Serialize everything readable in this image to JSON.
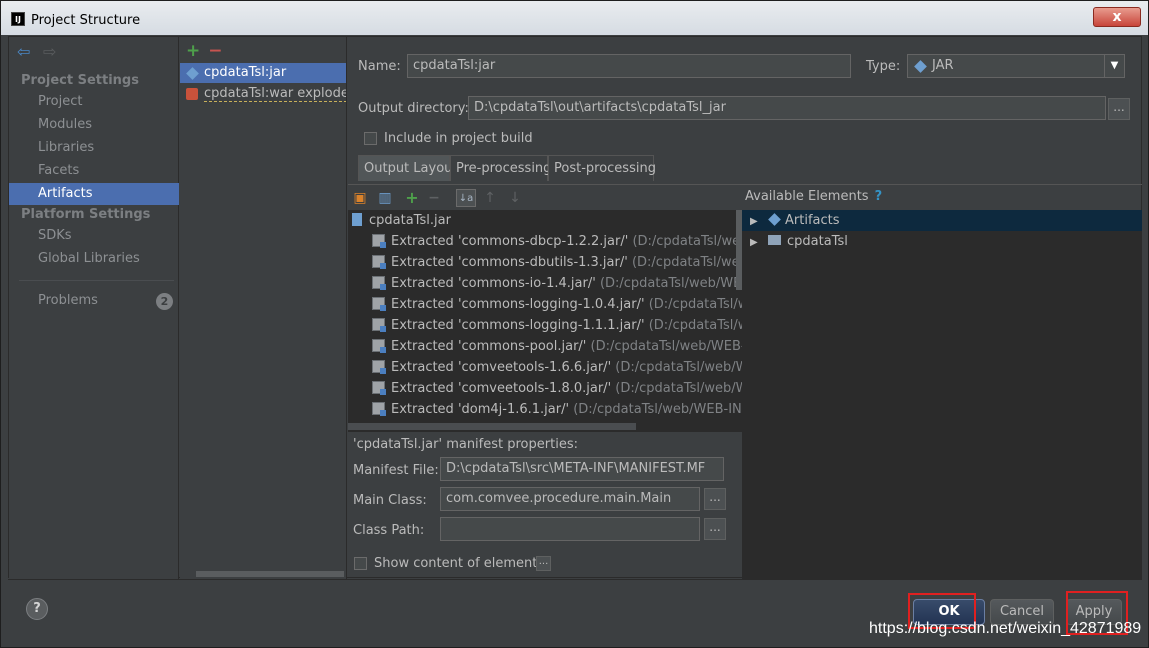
{
  "window": {
    "title": "Project Structure",
    "app_icon": "IJ",
    "close_label": "x"
  },
  "nav": {
    "back_icon": "arrow-left-icon",
    "forward_icon": "arrow-right-icon",
    "project_settings_header": "Project Settings",
    "project_items": [
      "Project",
      "Modules",
      "Libraries",
      "Facets",
      "Artifacts"
    ],
    "selected_item": "Artifacts",
    "platform_settings_header": "Platform Settings",
    "platform_items": [
      "SDKs",
      "Global Libraries"
    ],
    "problems_label": "Problems",
    "problems_count": "2"
  },
  "artifacts": {
    "add_icon": "+",
    "remove_icon": "−",
    "items": [
      {
        "label": "cpdataTsl:jar",
        "icon": "jar-icon",
        "selected": true
      },
      {
        "label": "cpdataTsl:war exploded",
        "icon": "war-icon",
        "selected": false
      }
    ]
  },
  "editor": {
    "name_label": "Name:",
    "name_value": "cpdataTsl:jar",
    "type_label": "Type:",
    "type_value": "JAR",
    "type_arrow": "▼",
    "output_dir_label": "Output directory:",
    "output_dir_value": "D:\\cpdataTsl\\out\\artifacts\\cpdataTsl_jar",
    "include_build_label": "Include in project build",
    "include_build_checked": false,
    "tabs": [
      "Output Layout",
      "Pre-processing",
      "Post-processing"
    ],
    "active_tab": "Output Layout",
    "ellipsis": "..."
  },
  "layout": {
    "root": "cpdataTsl.jar",
    "entries": [
      {
        "name": "Extracted 'commons-dbcp-1.2.2.jar/'",
        "path": "(D:/cpdataTsl/web/WEB-"
      },
      {
        "name": "Extracted 'commons-dbutils-1.3.jar/'",
        "path": "(D:/cpdataTsl/web/WEB-"
      },
      {
        "name": "Extracted 'commons-io-1.4.jar/'",
        "path": "(D:/cpdataTsl/web/WEB-INF/"
      },
      {
        "name": "Extracted 'commons-logging-1.0.4.jar/'",
        "path": "(D:/cpdataTsl/web/WE"
      },
      {
        "name": "Extracted 'commons-logging-1.1.1.jar/'",
        "path": "(D:/cpdataTsl/web/WI"
      },
      {
        "name": "Extracted 'commons-pool.jar/'",
        "path": "(D:/cpdataTsl/web/WEB-INF/li"
      },
      {
        "name": "Extracted 'comveetools-1.6.6.jar/'",
        "path": "(D:/cpdataTsl/web/WEB-IN"
      },
      {
        "name": "Extracted 'comveetools-1.8.0.jar/'",
        "path": "(D:/cpdataTsl/web/WEB-IN"
      },
      {
        "name": "Extracted 'dom4j-1.6.1.jar/'",
        "path": "(D:/cpdataTsl/web/WEB-INF/lib)"
      }
    ],
    "available_label": "Available Elements",
    "available_help": "?",
    "available_items": [
      {
        "label": "Artifacts",
        "icon": "artifacts-icon",
        "selected": true
      },
      {
        "label": "cpdataTsl",
        "icon": "module-folder-icon",
        "selected": false
      }
    ]
  },
  "manifest": {
    "heading": "'cpdataTsl.jar' manifest properties:",
    "file_label": "Manifest File:",
    "file_value": "D:\\cpdataTsl\\src\\META-INF\\MANIFEST.MF",
    "main_class_label": "Main Class:",
    "main_class_value": "com.comvee.procedure.main.Main",
    "class_path_label": "Class Path:",
    "class_path_value": "",
    "show_content_label": "Show content of elements"
  },
  "footer": {
    "help": "?",
    "ok": "OK",
    "cancel": "Cancel",
    "apply": "Apply",
    "watermark": "https://blog.csdn.net/weixin_42871989"
  },
  "colors": {
    "selection": "#4b6eaf",
    "highlight_box": "#e02020"
  }
}
